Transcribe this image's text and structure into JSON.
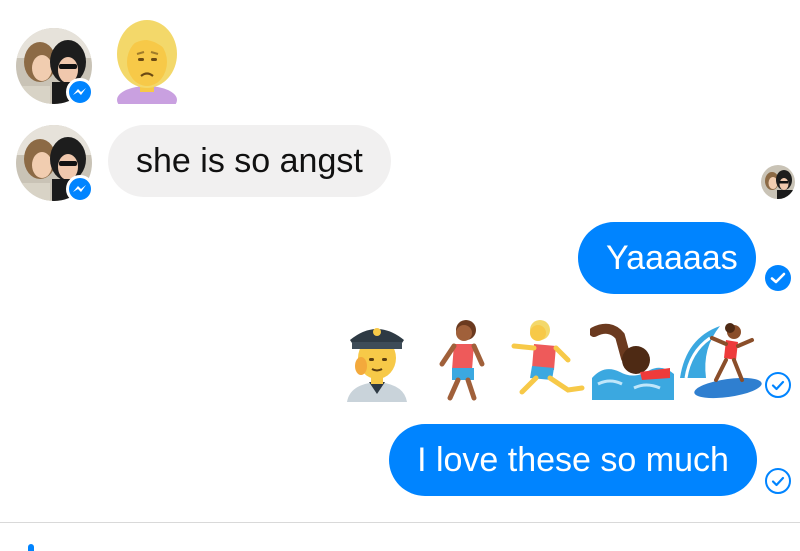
{
  "messages": {
    "incoming_text": "she is so angst",
    "outgoing_1": "Yaaaaas",
    "outgoing_2": "I love these so much"
  },
  "icons": {
    "sender_avatar": "profile-photo",
    "messenger_badge": "messenger-bolt-icon",
    "reaction_emoji": "person-frowning-emoji",
    "emoji_row": [
      "police-officer-emoji",
      "person-walking-emoji",
      "person-running-emoji",
      "person-swimming-emoji",
      "person-surfing-emoji"
    ],
    "read_receipt": "read-receipt-avatar",
    "delivered_receipt": "check-circle-icon",
    "sent_receipt": "check-outline-icon"
  },
  "colors": {
    "accent": "#0084ff",
    "incoming_bubble": "#f1f0f0",
    "background": "#ffffff"
  }
}
